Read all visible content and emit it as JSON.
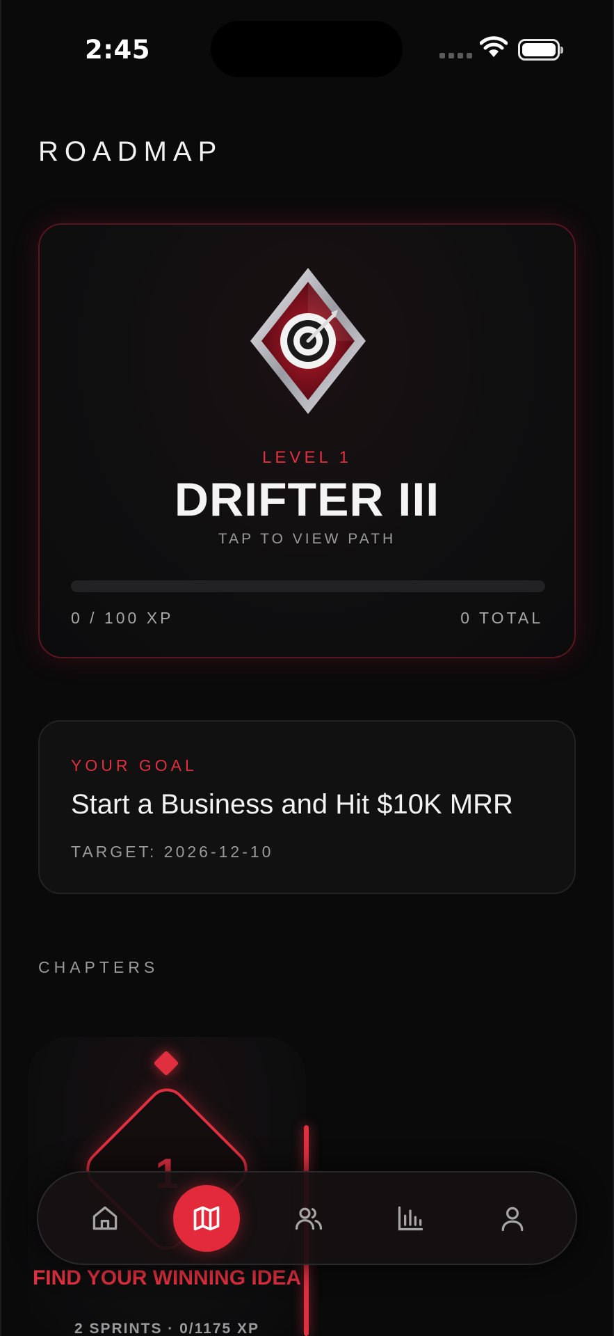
{
  "status_bar": {
    "time": "2:45"
  },
  "header": {
    "title": "ROADMAP"
  },
  "rank": {
    "level_label": "LEVEL 1",
    "name": "DRIFTER III",
    "hint": "TAP TO VIEW PATH",
    "xp_current": "0 / 100 XP",
    "xp_total": "0 TOTAL",
    "progress_fraction": 0
  },
  "goal": {
    "label": "YOUR GOAL",
    "text": "Start a Business and Hit $10K MRR",
    "target": "TARGET: 2026-12-10"
  },
  "chapters": {
    "section_label": "CHAPTERS",
    "items": [
      {
        "number": "1",
        "title": "FIND YOUR WINNING IDEA",
        "meta": "2 SPRINTS · 0/1175 XP"
      }
    ]
  },
  "nav": {
    "items": [
      {
        "icon": "home-icon",
        "active": false
      },
      {
        "icon": "map-icon",
        "active": true
      },
      {
        "icon": "users-icon",
        "active": false
      },
      {
        "icon": "bar-chart-icon",
        "active": false
      },
      {
        "icon": "profile-icon",
        "active": false
      }
    ]
  },
  "colors": {
    "accent": "#e0303f",
    "background": "#0a0a0b",
    "card": "#111112"
  }
}
